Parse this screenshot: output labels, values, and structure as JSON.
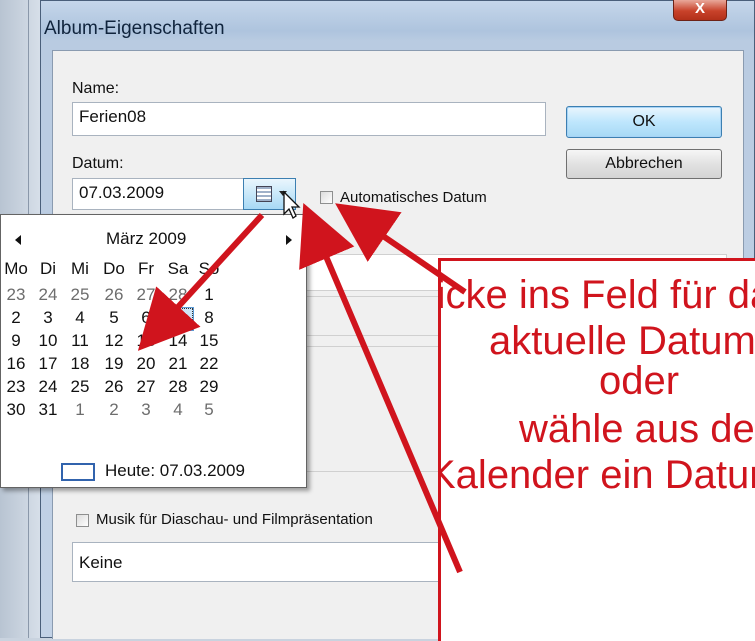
{
  "dialog": {
    "title": "Album-Eigenschaften",
    "close_label": "X",
    "name_label": "Name:",
    "name_value": "Ferien08",
    "date_label": "Datum:",
    "date_value": "07.03.2009",
    "auto_date_label": "Automatisches Datum",
    "ok_label": "OK",
    "cancel_label": "Abbrechen",
    "music_label": "Musik für Diaschau- und Filmpräsentation",
    "music_value": "Keine"
  },
  "calendar": {
    "month_label": "März 2009",
    "weekdays": [
      "Mo",
      "Di",
      "Mi",
      "Do",
      "Fr",
      "Sa",
      "So"
    ],
    "today_label": "Heute: 07.03.2009",
    "selected_day": "7",
    "weeks": [
      [
        "23",
        "24",
        "25",
        "26",
        "27",
        "28",
        "1"
      ],
      [
        "2",
        "3",
        "4",
        "5",
        "6",
        "7",
        "8"
      ],
      [
        "9",
        "10",
        "11",
        "12",
        "13",
        "14",
        "15"
      ],
      [
        "16",
        "17",
        "18",
        "19",
        "20",
        "21",
        "22"
      ],
      [
        "23",
        "24",
        "25",
        "26",
        "27",
        "28",
        "29"
      ],
      [
        "30",
        "31",
        "1",
        "2",
        "3",
        "4",
        "5"
      ]
    ]
  },
  "callout": {
    "lines": [
      "Klicke ins Feld für das",
      "aktuelle Datum",
      "oder",
      "wähle aus dem",
      "Kalender ein Datum"
    ],
    "color": "#d0141d"
  }
}
